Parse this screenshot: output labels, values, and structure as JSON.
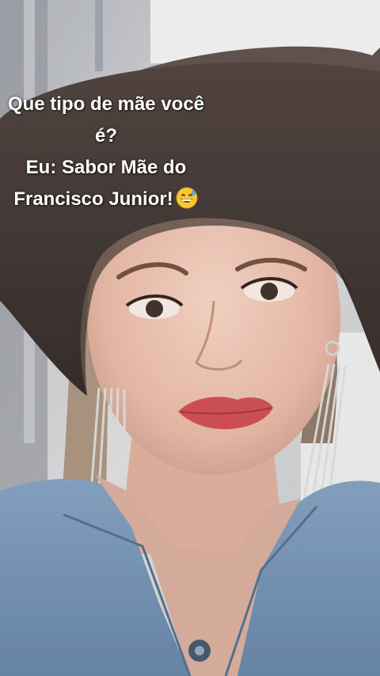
{
  "caption": {
    "line1": "Que tipo de mãe você",
    "line2": "é?",
    "line3": "Eu: Sabor Mãe do",
    "line4": "Francisco Junior!",
    "emoji_icon": "grinning-face-with-sweat-icon"
  },
  "colors": {
    "hat": "#3a2e2b",
    "denim": "#6f8fb0",
    "skin": "#e2b8a5",
    "lips": "#c9474a",
    "caption_text": "#ffffff"
  }
}
